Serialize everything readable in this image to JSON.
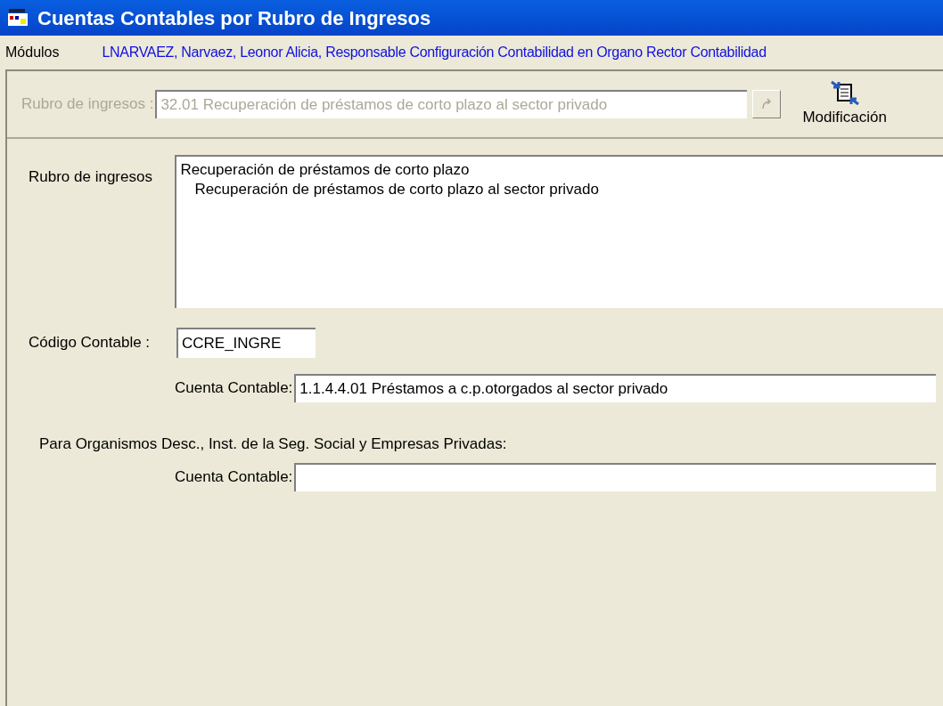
{
  "window": {
    "title": "Cuentas Contables por Rubro de Ingresos"
  },
  "menu": {
    "label": "Módulos",
    "user": "LNARVAEZ, Narvaez, Leonor Alicia, Responsable Configuración Contabilidad en Organo Rector Contabilidad"
  },
  "toolbar": {
    "label": "Rubro de ingresos :",
    "value": "32.01 Recuperación de préstamos de corto plazo al sector privado",
    "disabled": true,
    "action": "Modificación"
  },
  "rubro": {
    "label": "Rubro de ingresos",
    "tree": [
      {
        "label": "Recuperación de préstamos de corto plazo",
        "children": [
          {
            "label": "Recuperación de préstamos de corto plazo al sector privado"
          }
        ]
      }
    ]
  },
  "codigo": {
    "label": "Código Contable :",
    "value": "CCRE_INGRE"
  },
  "cuenta": {
    "label": "Cuenta Contable:",
    "value": "1.1.4.4.01 Préstamos a c.p.otorgados al sector privado"
  },
  "organismos": {
    "heading": "Para Organismos Desc., Inst. de la Seg. Social y Empresas Privadas:",
    "label": "Cuenta Contable:"
  }
}
